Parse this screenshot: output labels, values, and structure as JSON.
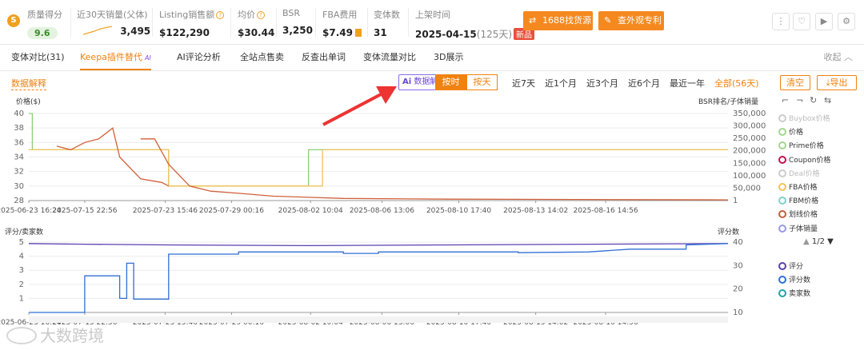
{
  "metrics": {
    "quality": {
      "label": "质量得分",
      "value": "9.6"
    },
    "sales30": {
      "label": "近30天销量(父体)",
      "value": "3,495"
    },
    "revenue": {
      "label": "Listing销售额",
      "value": "$122,290"
    },
    "avg_price": {
      "label": "均价",
      "value": "$30.44"
    },
    "bsr": {
      "label": "BSR",
      "value": "3,250"
    },
    "fba": {
      "label": "FBA费用",
      "value": "$7.49"
    },
    "variants": {
      "label": "变体数",
      "value": "31"
    },
    "listed": {
      "label": "上架时间",
      "value": "2025-04-15",
      "days": "(125天)",
      "tag": "新品"
    }
  },
  "buttons": {
    "source": "1688找货源",
    "patent": "查外观专利"
  },
  "tabs": [
    "变体对比(31)",
    "Keepa插件替代",
    "AI评论分析",
    "全站点售卖",
    "反查出单词",
    "变体流量对比",
    "3D展示"
  ],
  "ai_badge": "AI",
  "collapse": "收起",
  "data_hint": "数据解释",
  "ai_button": "数据解读",
  "granularity": {
    "hour": "按时",
    "day": "按天"
  },
  "ranges": [
    "近7天",
    "近1个月",
    "近3个月",
    "近6个月",
    "最近一年",
    "全部(56天)"
  ],
  "side_buttons": {
    "clear": "清空",
    "export": "导出"
  },
  "legend1": [
    {
      "label": "Buybox价格",
      "color": "#cccccc",
      "dim": true
    },
    {
      "label": "价格",
      "color": "#a3d68f",
      "dim": false
    },
    {
      "label": "Prime价格",
      "color": "#a3d68f",
      "dim": false
    },
    {
      "label": "Coupon价格",
      "color": "#c0144c",
      "dim": false
    },
    {
      "label": "Deal价格",
      "color": "#cccccc",
      "dim": true
    },
    {
      "label": "FBA价格",
      "color": "#f2c257",
      "dim": false
    },
    {
      "label": "FBM价格",
      "color": "#7fd0c9",
      "dim": false
    },
    {
      "label": "划线价格",
      "color": "#c0603a",
      "dim": false
    },
    {
      "label": "子体销量",
      "color": "#9d96e8",
      "dim": false
    }
  ],
  "pager": "1/2",
  "legend2": [
    {
      "label": "评分",
      "color": "#5b3fb0"
    },
    {
      "label": "评分数",
      "color": "#2f6fd6"
    },
    {
      "label": "卖家数",
      "color": "#21a3a8"
    }
  ],
  "chart_data": [
    {
      "type": "line",
      "ylabel": "价格($)",
      "y2label": "BSR排名/子体销量",
      "yticks": [
        28,
        30,
        32,
        34,
        36,
        38,
        40
      ],
      "y2ticks": [
        "1",
        "50,000",
        "100,000",
        "150,000",
        "200,000",
        "250,000",
        "300,000",
        "350,000"
      ],
      "xticks": [
        "2025-06-23 16:24",
        "2025-07-15 22:56",
        "2025-07-23 15:46",
        "2025-07-29 00:16",
        "2025-08-02 10:04",
        "2025-08-06 13:06",
        "2025-08-10 17:40",
        "2025-08-13 14:02",
        "2025-08-16 14:56"
      ],
      "series": [
        {
          "name": "价格",
          "color": "#8ccf76",
          "points": [
            [
              0,
              40
            ],
            [
              0.5,
              40
            ],
            [
              0.5,
              35
            ],
            [
              20,
              35
            ],
            [
              20,
              30
            ],
            [
              40,
              30
            ],
            [
              40,
              35
            ],
            [
              100,
              35
            ]
          ]
        },
        {
          "name": "FBA价格",
          "color": "#f2c257",
          "points": [
            [
              0,
              35
            ],
            [
              20,
              35
            ],
            [
              20,
              30
            ],
            [
              42,
              30
            ],
            [
              42,
              35
            ],
            [
              100,
              35
            ]
          ]
        },
        {
          "name": "划线价格",
          "color": "#d0603a",
          "points": [
            [
              4,
              35.5
            ],
            [
              6,
              35
            ],
            [
              8,
              36
            ],
            [
              10,
              36.5
            ],
            [
              12,
              38
            ],
            [
              13,
              34
            ],
            [
              16,
              31
            ],
            [
              19,
              30.5
            ],
            [
              20,
              30
            ]
          ]
        },
        {
          "name": "划线价格",
          "color": "#d0603a",
          "points": [
            [
              16,
              36.5
            ],
            [
              18,
              36.5
            ],
            [
              20,
              33
            ],
            [
              23,
              30
            ],
            [
              26,
              29.3
            ],
            [
              30,
              29
            ],
            [
              35,
              28.6
            ],
            [
              45,
              28.3
            ],
            [
              60,
              28.2
            ],
            [
              100,
              28.1
            ]
          ]
        }
      ]
    },
    {
      "type": "line",
      "ylabel": "评分/卖家数",
      "y2label": "评分数",
      "yticks": [
        1,
        2,
        3,
        4,
        5
      ],
      "y2ticks": [
        10,
        20,
        30,
        40
      ],
      "xticks": [
        "2025-06-23 16:24",
        "2025-07-15 22:56",
        "2025-07-23 15:46",
        "2025-07-29 00:16",
        "2025-08-02 10:04",
        "2025-08-06 13:06",
        "2025-08-10 17:40",
        "2025-08-13 14:02",
        "2025-08-16 14:56"
      ],
      "series": [
        {
          "name": "评分",
          "color": "#5b3fb0",
          "points": [
            [
              0,
              4.9
            ],
            [
              8,
              4.85
            ],
            [
              20,
              4.8
            ],
            [
              40,
              4.75
            ],
            [
              60,
              4.8
            ],
            [
              80,
              4.85
            ],
            [
              100,
              4.9
            ]
          ]
        },
        {
          "name": "评分数",
          "color": "#2f6fd6",
          "points": [
            [
              0,
              0
            ],
            [
              8,
              0
            ],
            [
              8,
              2.6
            ],
            [
              13,
              2.6
            ],
            [
              13,
              1
            ],
            [
              14,
              1
            ],
            [
              14,
              3.5
            ],
            [
              15,
              3.5
            ],
            [
              15,
              0.95
            ],
            [
              20,
              0.95
            ],
            [
              20,
              4.15
            ],
            [
              30,
              4.15
            ],
            [
              30,
              4.3
            ],
            [
              45,
              4.3
            ],
            [
              45,
              4.2
            ],
            [
              50,
              4.2
            ],
            [
              50,
              4.3
            ],
            [
              70,
              4.3
            ],
            [
              70,
              4.25
            ],
            [
              80,
              4.3
            ],
            [
              86,
              4.5
            ],
            [
              94,
              4.5
            ],
            [
              94,
              4.8
            ],
            [
              100,
              4.9
            ]
          ]
        }
      ]
    }
  ]
}
